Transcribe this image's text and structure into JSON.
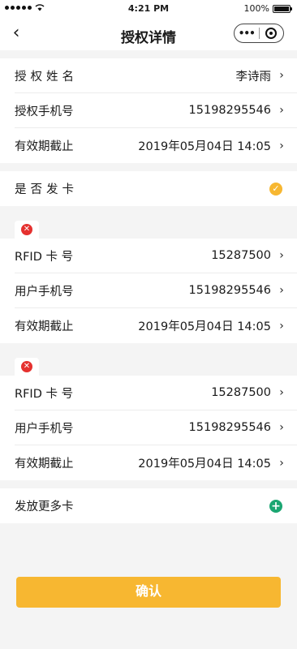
{
  "statusbar": {
    "time": "4:21 PM",
    "battery": "100%"
  },
  "nav": {
    "back_icon": "‹",
    "title": "授权详情"
  },
  "auth": [
    {
      "label": "授权姓名",
      "value": "李诗雨"
    },
    {
      "label": "授权手机号",
      "value": "15198295546"
    },
    {
      "label": "有效期截止",
      "value": "2019年05月04日 14:05"
    }
  ],
  "issue_card": {
    "label": "是否发卡",
    "checked": true
  },
  "cards": [
    {
      "rows": [
        {
          "label": "RFID 卡 号",
          "value": "15287500"
        },
        {
          "label": "用户手机号",
          "value": "15198295546"
        },
        {
          "label": "有效期截止",
          "value": "2019年05月04日 14:05"
        }
      ]
    },
    {
      "rows": [
        {
          "label": "RFID 卡 号",
          "value": "15287500"
        },
        {
          "label": "用户手机号",
          "value": "15198295546"
        },
        {
          "label": "有效期截止",
          "value": "2019年05月04日 14:05"
        }
      ]
    }
  ],
  "more_cards": {
    "label": "发放更多卡"
  },
  "confirm": {
    "label": "确认"
  },
  "colors": {
    "accent": "#f7b731",
    "delete": "#e5312f",
    "add": "#1ba672"
  }
}
